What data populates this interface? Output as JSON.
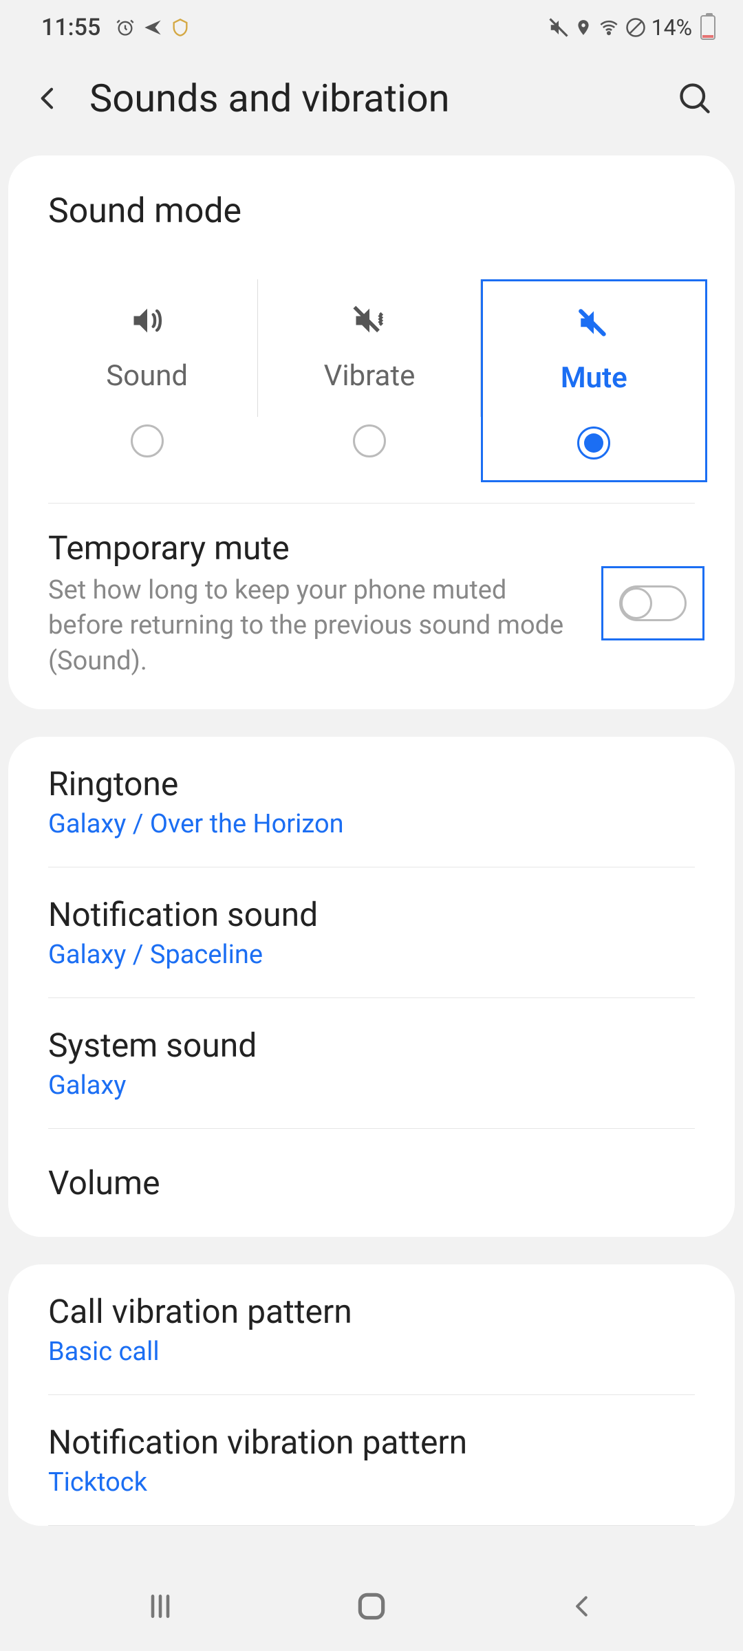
{
  "status": {
    "time": "11:55",
    "battery_pct": "14%"
  },
  "header": {
    "title": "Sounds and vibration"
  },
  "sound_mode": {
    "section_title": "Sound mode",
    "options": [
      {
        "label": "Sound",
        "selected": false
      },
      {
        "label": "Vibrate",
        "selected": false
      },
      {
        "label": "Mute",
        "selected": true
      }
    ]
  },
  "temporary_mute": {
    "title": "Temporary mute",
    "description": "Set how long to keep your phone muted before returning to the previous sound mode (Sound).",
    "enabled": false
  },
  "sound_list": [
    {
      "title": "Ringtone",
      "value": "Galaxy / Over the Horizon"
    },
    {
      "title": "Notification sound",
      "value": "Galaxy / Spaceline"
    },
    {
      "title": "System sound",
      "value": "Galaxy"
    },
    {
      "title": "Volume",
      "value": null
    }
  ],
  "vibration_list": [
    {
      "title": "Call vibration pattern",
      "value": "Basic call"
    },
    {
      "title": "Notification vibration pattern",
      "value": "Ticktock"
    }
  ]
}
